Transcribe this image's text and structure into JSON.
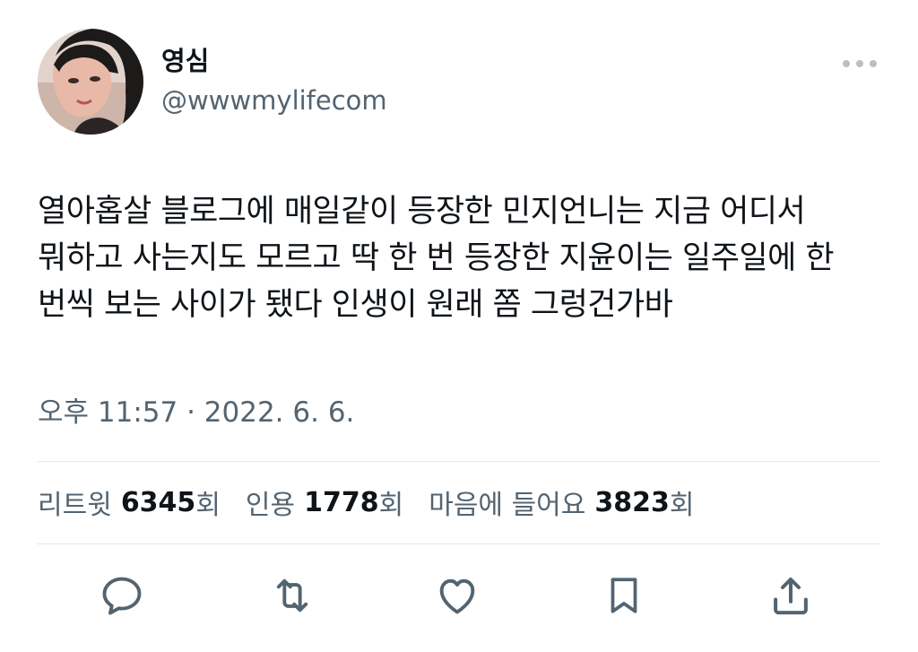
{
  "user": {
    "display_name": "영심",
    "handle": "@wwwmylifecom",
    "avatar_icon": "profile-photo"
  },
  "tweet": {
    "lines": [
      "열아홉살 블로그에 매일같이 등장한 민지언니는 지금 어디서",
      "뭐하고 사는지도 모르고 딱 한 번 등장한 지윤이는 일주일에 한",
      "번씩 보는 사이가 됐다 인생이 원래 쫌 그렁건가바"
    ],
    "timestamp": "오후 11:57 · 2022. 6. 6."
  },
  "stats": {
    "retweets_label": "리트윗",
    "retweets_count": "6345",
    "retweets_suffix": "회",
    "quotes_label": "인용",
    "quotes_count": "1778",
    "quotes_suffix": "회",
    "likes_label": "마음에 들어요",
    "likes_count": "3823",
    "likes_suffix": "회"
  },
  "actions": {
    "icons": [
      "reply-icon",
      "retweet-icon",
      "like-icon",
      "bookmark-icon",
      "share-icon"
    ]
  },
  "colors": {
    "text": "#0f1419",
    "secondary": "#536471",
    "divider": "#e1e6ea",
    "more_dots": "#b7c0c7"
  }
}
